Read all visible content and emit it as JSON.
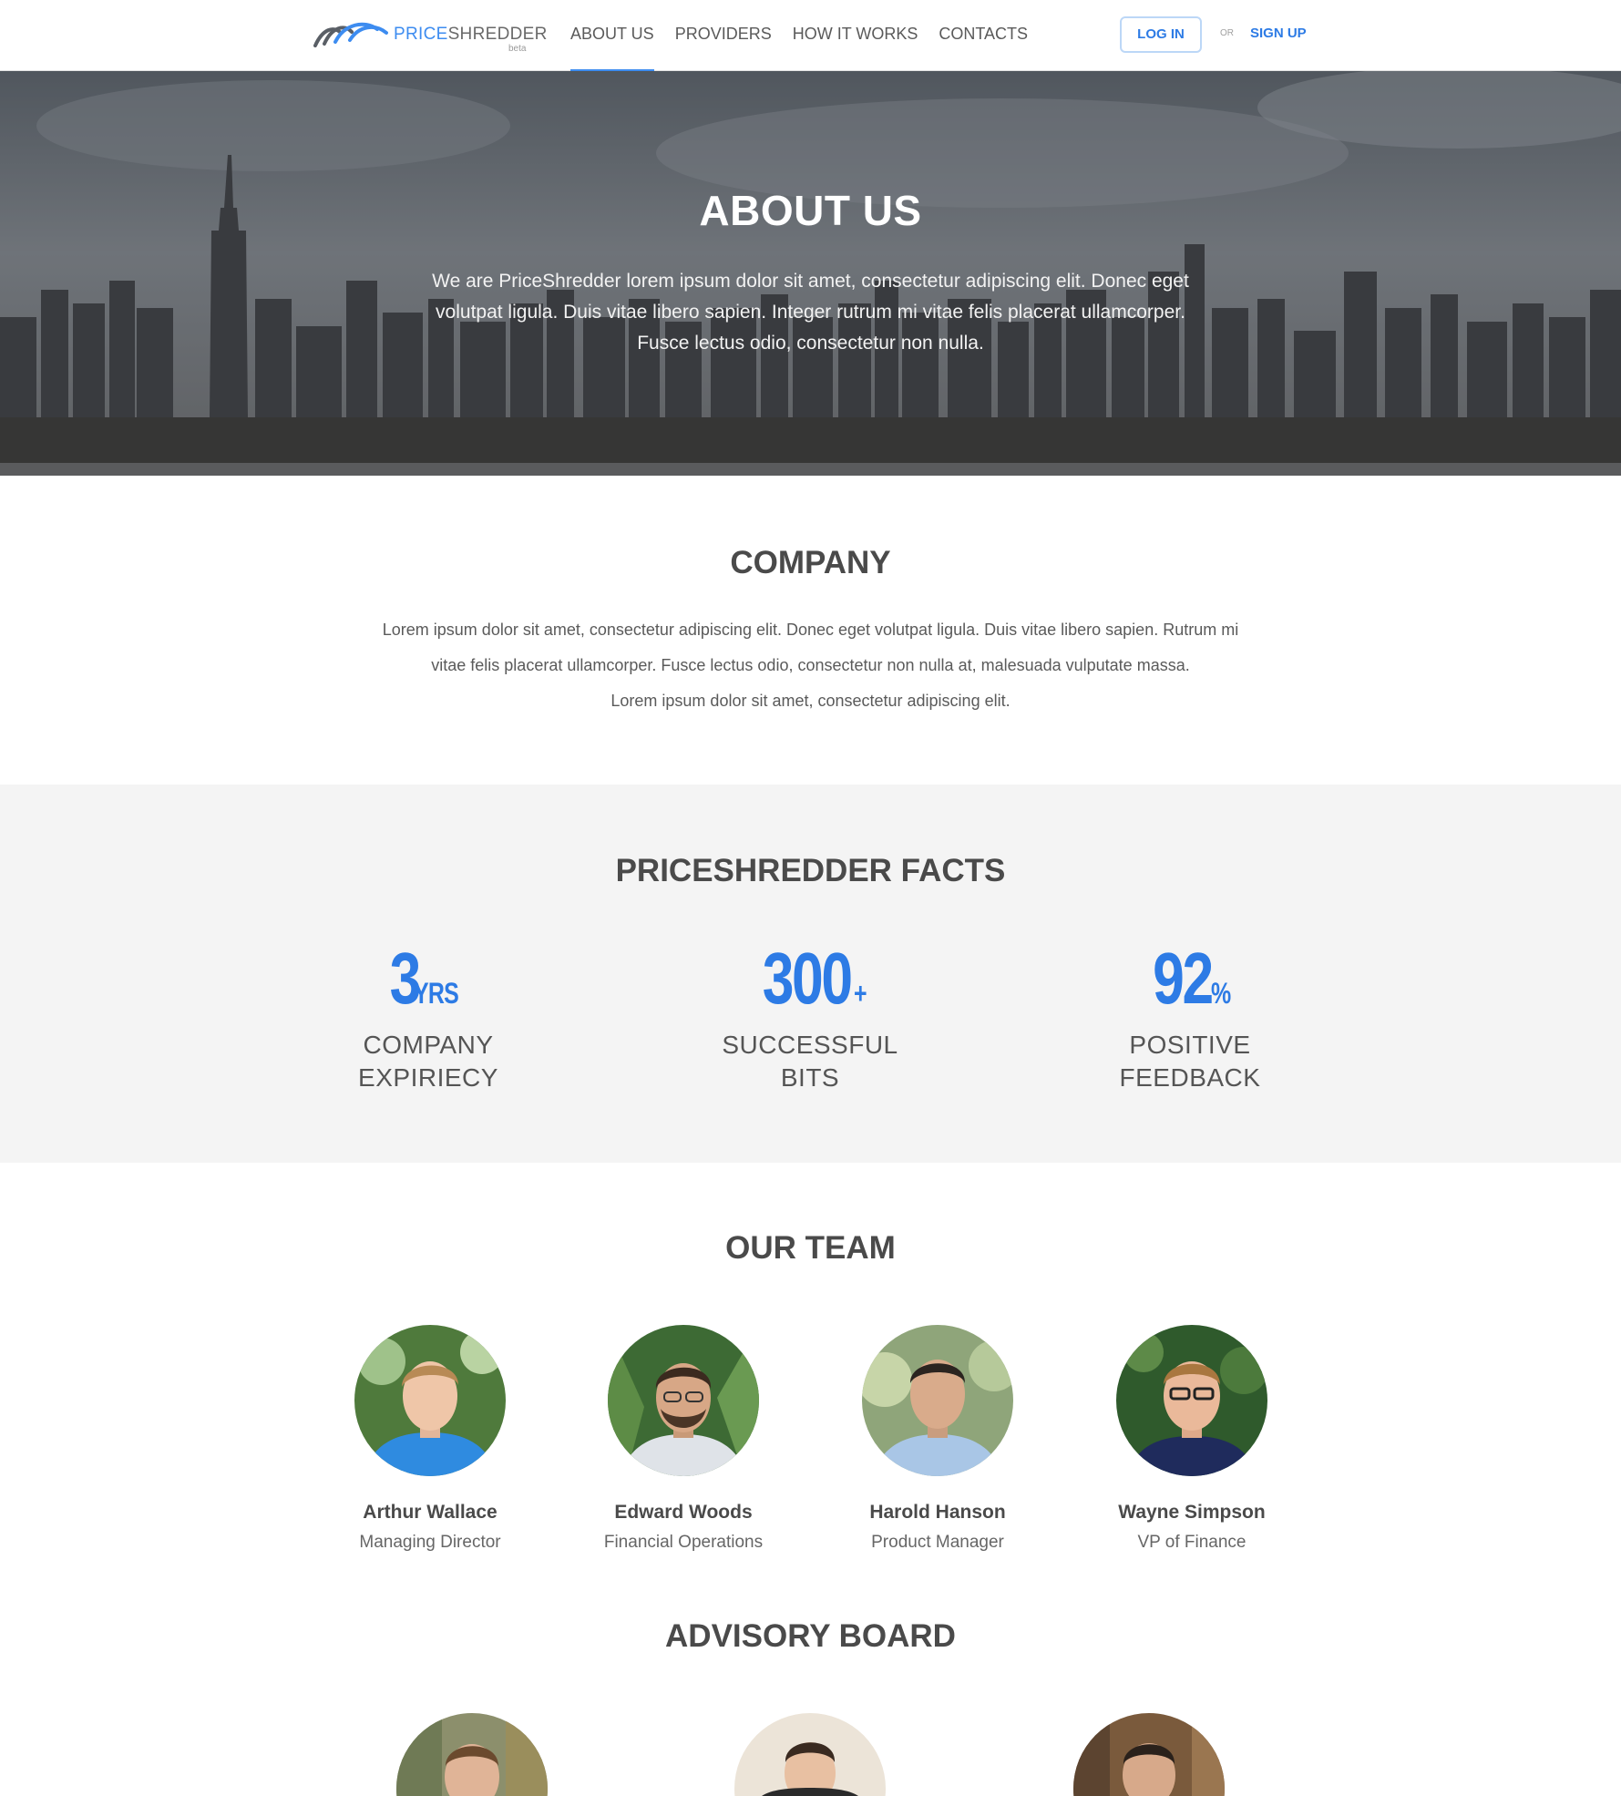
{
  "nav": {
    "logo": {
      "word_a": "PRICE",
      "word_b": "SHREDDER",
      "badge": "beta"
    },
    "items": [
      {
        "label": "ABOUT US",
        "active": true
      },
      {
        "label": "PROVIDERS",
        "active": false
      },
      {
        "label": "HOW IT WORKS",
        "active": false
      },
      {
        "label": "CONTACTS",
        "active": false
      }
    ],
    "login_label": "LOG IN",
    "or_label": "OR",
    "signup_label": "SIGN UP"
  },
  "hero": {
    "title": "ABOUT US",
    "text": "We are PriceShredder lorem ipsum dolor sit amet, consectetur adipiscing elit. Donec eget volutpat ligula. Duis vitae libero sapien. Integer rutrum mi vitae felis placerat ullamcorper. Fusce lectus odio, consectetur non nulla."
  },
  "company": {
    "title": "COMPANY",
    "lines": [
      "Lorem ipsum dolor sit amet, consectetur adipiscing elit.  Donec eget volutpat ligula. Duis vitae libero sapien. Rutrum mi",
      "vitae felis placerat ullamcorper. Fusce lectus odio, consectetur non nulla at, malesuada vulputate massa.",
      "Lorem ipsum dolor sit amet, consectetur adipiscing elit."
    ]
  },
  "facts": {
    "title": "PRICESHREDDER FACTS",
    "items": [
      {
        "value": "3",
        "suffix": "YRS",
        "label_line1": "COMPANY",
        "label_line2": "EXPIRIECY"
      },
      {
        "value": "300",
        "suffix": "+",
        "label_line1": "SUCCESSFUL",
        "label_line2": "BITS"
      },
      {
        "value": "92",
        "suffix": "%",
        "label_line1": "POSITIVE",
        "label_line2": "FEEDBACK"
      }
    ]
  },
  "team": {
    "title": "OUR TEAM",
    "members": [
      {
        "name": "Arthur Wallace",
        "role": "Managing Director"
      },
      {
        "name": "Edward Woods",
        "role": "Financial Operations"
      },
      {
        "name": "Harold Hanson",
        "role": "Product Manager"
      },
      {
        "name": "Wayne Simpson",
        "role": "VP of Finance"
      }
    ]
  },
  "advisory": {
    "title": "ADVISORY BOARD"
  },
  "colors": {
    "accent": "#2d7be5",
    "text": "#4a4a4a",
    "facts_bg": "#f4f4f4"
  }
}
